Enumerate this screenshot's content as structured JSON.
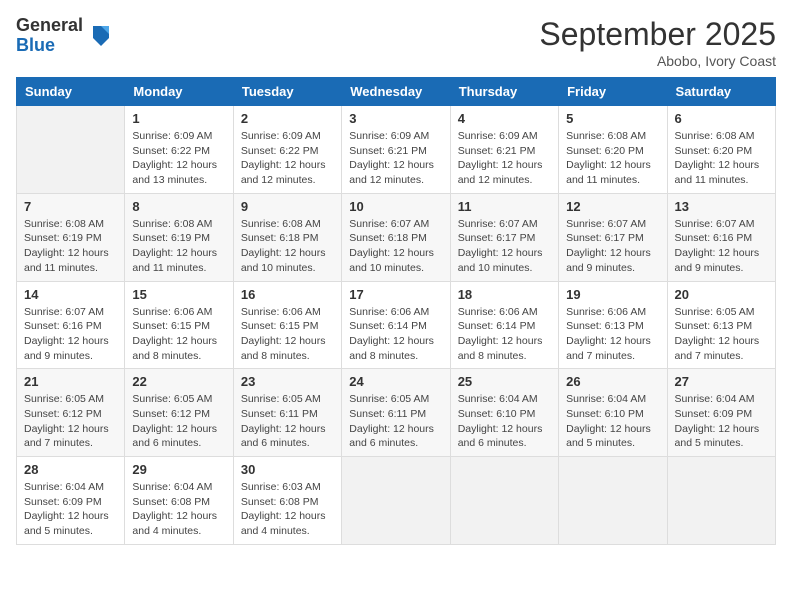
{
  "header": {
    "logo_general": "General",
    "logo_blue": "Blue",
    "month_title": "September 2025",
    "subtitle": "Abobo, Ivory Coast"
  },
  "weekdays": [
    "Sunday",
    "Monday",
    "Tuesday",
    "Wednesday",
    "Thursday",
    "Friday",
    "Saturday"
  ],
  "weeks": [
    [
      {
        "day": "",
        "sunrise": "",
        "sunset": "",
        "daylight": ""
      },
      {
        "day": "1",
        "sunrise": "Sunrise: 6:09 AM",
        "sunset": "Sunset: 6:22 PM",
        "daylight": "Daylight: 12 hours and 13 minutes."
      },
      {
        "day": "2",
        "sunrise": "Sunrise: 6:09 AM",
        "sunset": "Sunset: 6:22 PM",
        "daylight": "Daylight: 12 hours and 12 minutes."
      },
      {
        "day": "3",
        "sunrise": "Sunrise: 6:09 AM",
        "sunset": "Sunset: 6:21 PM",
        "daylight": "Daylight: 12 hours and 12 minutes."
      },
      {
        "day": "4",
        "sunrise": "Sunrise: 6:09 AM",
        "sunset": "Sunset: 6:21 PM",
        "daylight": "Daylight: 12 hours and 12 minutes."
      },
      {
        "day": "5",
        "sunrise": "Sunrise: 6:08 AM",
        "sunset": "Sunset: 6:20 PM",
        "daylight": "Daylight: 12 hours and 11 minutes."
      },
      {
        "day": "6",
        "sunrise": "Sunrise: 6:08 AM",
        "sunset": "Sunset: 6:20 PM",
        "daylight": "Daylight: 12 hours and 11 minutes."
      }
    ],
    [
      {
        "day": "7",
        "sunrise": "Sunrise: 6:08 AM",
        "sunset": "Sunset: 6:19 PM",
        "daylight": "Daylight: 12 hours and 11 minutes."
      },
      {
        "day": "8",
        "sunrise": "Sunrise: 6:08 AM",
        "sunset": "Sunset: 6:19 PM",
        "daylight": "Daylight: 12 hours and 11 minutes."
      },
      {
        "day": "9",
        "sunrise": "Sunrise: 6:08 AM",
        "sunset": "Sunset: 6:18 PM",
        "daylight": "Daylight: 12 hours and 10 minutes."
      },
      {
        "day": "10",
        "sunrise": "Sunrise: 6:07 AM",
        "sunset": "Sunset: 6:18 PM",
        "daylight": "Daylight: 12 hours and 10 minutes."
      },
      {
        "day": "11",
        "sunrise": "Sunrise: 6:07 AM",
        "sunset": "Sunset: 6:17 PM",
        "daylight": "Daylight: 12 hours and 10 minutes."
      },
      {
        "day": "12",
        "sunrise": "Sunrise: 6:07 AM",
        "sunset": "Sunset: 6:17 PM",
        "daylight": "Daylight: 12 hours and 9 minutes."
      },
      {
        "day": "13",
        "sunrise": "Sunrise: 6:07 AM",
        "sunset": "Sunset: 6:16 PM",
        "daylight": "Daylight: 12 hours and 9 minutes."
      }
    ],
    [
      {
        "day": "14",
        "sunrise": "Sunrise: 6:07 AM",
        "sunset": "Sunset: 6:16 PM",
        "daylight": "Daylight: 12 hours and 9 minutes."
      },
      {
        "day": "15",
        "sunrise": "Sunrise: 6:06 AM",
        "sunset": "Sunset: 6:15 PM",
        "daylight": "Daylight: 12 hours and 8 minutes."
      },
      {
        "day": "16",
        "sunrise": "Sunrise: 6:06 AM",
        "sunset": "Sunset: 6:15 PM",
        "daylight": "Daylight: 12 hours and 8 minutes."
      },
      {
        "day": "17",
        "sunrise": "Sunrise: 6:06 AM",
        "sunset": "Sunset: 6:14 PM",
        "daylight": "Daylight: 12 hours and 8 minutes."
      },
      {
        "day": "18",
        "sunrise": "Sunrise: 6:06 AM",
        "sunset": "Sunset: 6:14 PM",
        "daylight": "Daylight: 12 hours and 8 minutes."
      },
      {
        "day": "19",
        "sunrise": "Sunrise: 6:06 AM",
        "sunset": "Sunset: 6:13 PM",
        "daylight": "Daylight: 12 hours and 7 minutes."
      },
      {
        "day": "20",
        "sunrise": "Sunrise: 6:05 AM",
        "sunset": "Sunset: 6:13 PM",
        "daylight": "Daylight: 12 hours and 7 minutes."
      }
    ],
    [
      {
        "day": "21",
        "sunrise": "Sunrise: 6:05 AM",
        "sunset": "Sunset: 6:12 PM",
        "daylight": "Daylight: 12 hours and 7 minutes."
      },
      {
        "day": "22",
        "sunrise": "Sunrise: 6:05 AM",
        "sunset": "Sunset: 6:12 PM",
        "daylight": "Daylight: 12 hours and 6 minutes."
      },
      {
        "day": "23",
        "sunrise": "Sunrise: 6:05 AM",
        "sunset": "Sunset: 6:11 PM",
        "daylight": "Daylight: 12 hours and 6 minutes."
      },
      {
        "day": "24",
        "sunrise": "Sunrise: 6:05 AM",
        "sunset": "Sunset: 6:11 PM",
        "daylight": "Daylight: 12 hours and 6 minutes."
      },
      {
        "day": "25",
        "sunrise": "Sunrise: 6:04 AM",
        "sunset": "Sunset: 6:10 PM",
        "daylight": "Daylight: 12 hours and 6 minutes."
      },
      {
        "day": "26",
        "sunrise": "Sunrise: 6:04 AM",
        "sunset": "Sunset: 6:10 PM",
        "daylight": "Daylight: 12 hours and 5 minutes."
      },
      {
        "day": "27",
        "sunrise": "Sunrise: 6:04 AM",
        "sunset": "Sunset: 6:09 PM",
        "daylight": "Daylight: 12 hours and 5 minutes."
      }
    ],
    [
      {
        "day": "28",
        "sunrise": "Sunrise: 6:04 AM",
        "sunset": "Sunset: 6:09 PM",
        "daylight": "Daylight: 12 hours and 5 minutes."
      },
      {
        "day": "29",
        "sunrise": "Sunrise: 6:04 AM",
        "sunset": "Sunset: 6:08 PM",
        "daylight": "Daylight: 12 hours and 4 minutes."
      },
      {
        "day": "30",
        "sunrise": "Sunrise: 6:03 AM",
        "sunset": "Sunset: 6:08 PM",
        "daylight": "Daylight: 12 hours and 4 minutes."
      },
      {
        "day": "",
        "sunrise": "",
        "sunset": "",
        "daylight": ""
      },
      {
        "day": "",
        "sunrise": "",
        "sunset": "",
        "daylight": ""
      },
      {
        "day": "",
        "sunrise": "",
        "sunset": "",
        "daylight": ""
      },
      {
        "day": "",
        "sunrise": "",
        "sunset": "",
        "daylight": ""
      }
    ]
  ]
}
